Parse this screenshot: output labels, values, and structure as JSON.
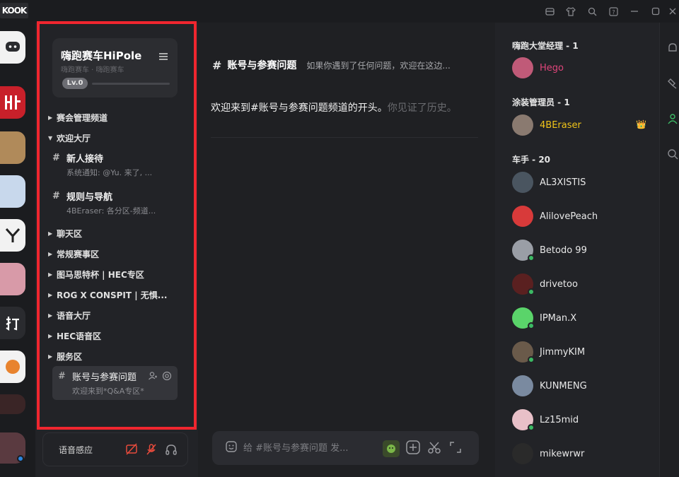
{
  "app": {
    "brand": "KOOK"
  },
  "guild": {
    "name": "嗨跑赛车HiPole",
    "subtitle": "嗨跑赛车 · 嗨跑赛车",
    "level": "Lv.0"
  },
  "categories": [
    {
      "label": "赛会管理频道",
      "expanded": false
    },
    {
      "label": "欢迎大厅",
      "expanded": true
    },
    {
      "label": "聊天区",
      "expanded": false
    },
    {
      "label": "常规赛事区",
      "expanded": false
    },
    {
      "label": "图马思特杯 | HEC专区",
      "expanded": false
    },
    {
      "label": "ROG X CONSPIT | 无惧...",
      "expanded": false
    },
    {
      "label": "语音大厅",
      "expanded": false
    },
    {
      "label": "HEC语音区",
      "expanded": false
    },
    {
      "label": "服务区",
      "expanded": false
    }
  ],
  "channels": [
    {
      "name": "新人接待",
      "preview": "系统通知: @Yu. 来了, ..."
    },
    {
      "name": "规则与导航",
      "preview": "4BEraser: 各分区-频道..."
    }
  ],
  "active_channel": {
    "name": "账号与参赛问题",
    "preview": "欢迎来到*Q&A专区*"
  },
  "voice": {
    "label": "语音感应"
  },
  "main": {
    "title": "账号与参赛问题",
    "topic": "如果你遇到了任何问题，欢迎在这边...",
    "welcome_text": "欢迎来到#账号与参赛问题频道的开头。",
    "welcome_muted": "你见证了历史。",
    "composer_placeholder": "给 #账号与参赛问题 发..."
  },
  "member_groups": [
    {
      "title": "嗨跑大堂经理 - 1",
      "members": [
        {
          "name": "Hego",
          "color": "#e0457b",
          "online": false
        }
      ]
    },
    {
      "title": "涂装管理员 - 1",
      "members": [
        {
          "name": "4BEraser",
          "color": "#f0c419",
          "online": false,
          "crown": true
        }
      ]
    },
    {
      "title": "车手 - 20",
      "members": [
        {
          "name": "AL3XISTIS",
          "color": "#e8e8e8",
          "online": false
        },
        {
          "name": "AlilovePeach",
          "color": "#e8e8e8",
          "online": false
        },
        {
          "name": "Betodo 99",
          "color": "#e8e8e8",
          "online": true
        },
        {
          "name": "drivetoo",
          "color": "#e8e8e8",
          "online": true
        },
        {
          "name": "IPMan.X",
          "color": "#e8e8e8",
          "online": true
        },
        {
          "name": "JimmyKIM",
          "color": "#e8e8e8",
          "online": true
        },
        {
          "name": "KUNMENG",
          "color": "#e8e8e8",
          "online": false
        },
        {
          "name": "Lz15mid",
          "color": "#e8e8e8",
          "online": true
        },
        {
          "name": "mikewrwr",
          "color": "#e8e8e8",
          "online": false
        }
      ]
    }
  ],
  "colors": {
    "highlight": "#f0262f",
    "mute_red": "#e84b3c",
    "online_green": "#3cb964"
  }
}
